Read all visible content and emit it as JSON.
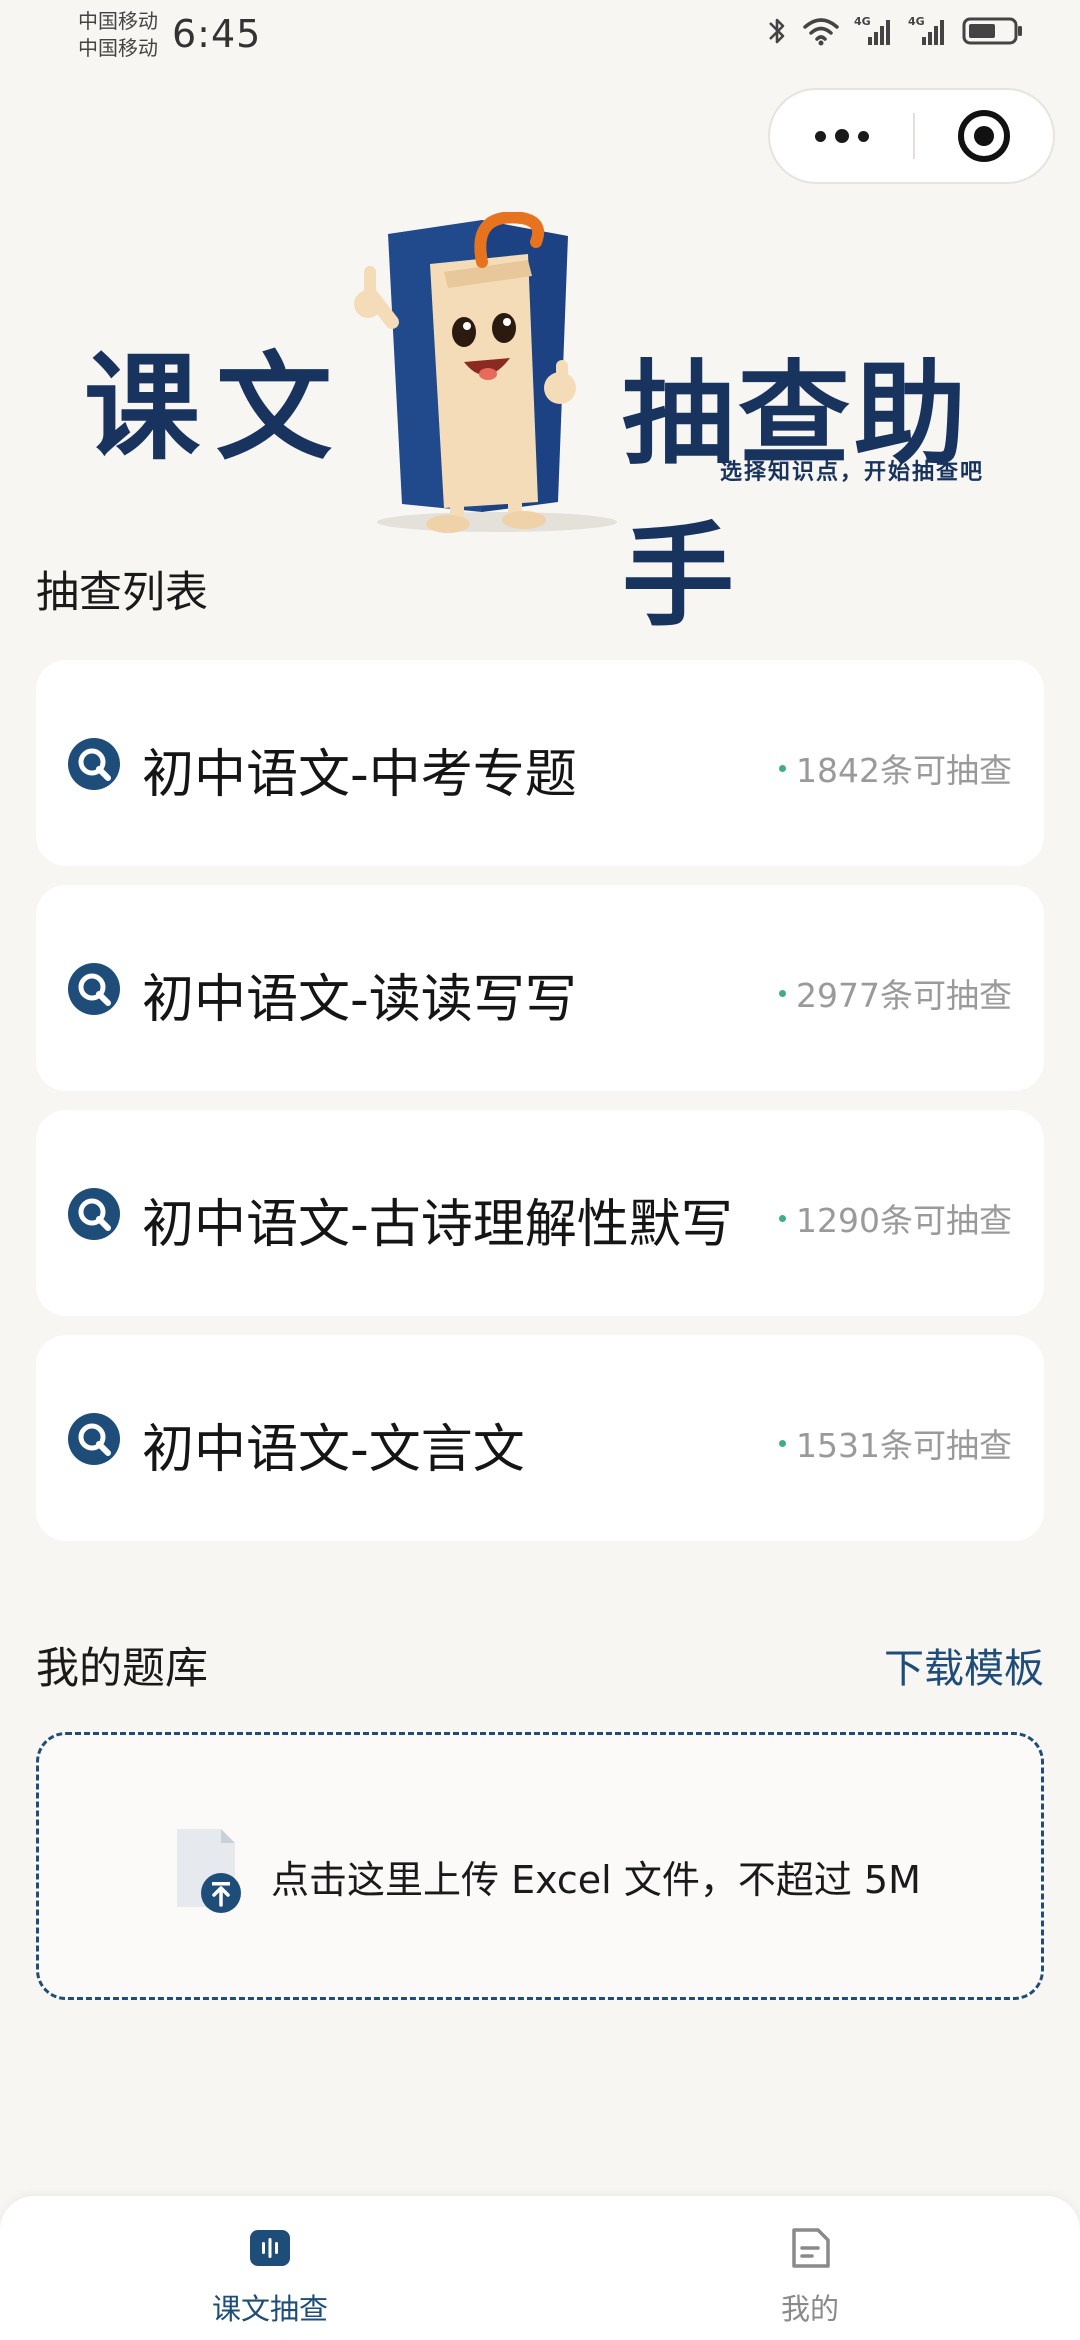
{
  "status_bar": {
    "carrier_1": "中国移动",
    "carrier_2": "中国移动",
    "time": "6:45",
    "icons": [
      "bluetooth-icon",
      "wifi-icon",
      "signal-4g-icon",
      "signal-4g-icon",
      "battery-icon"
    ],
    "network_1": "4G",
    "network_2": "4G"
  },
  "capsule": {
    "more_icon": "more-dots-icon",
    "close_icon": "target-close-icon"
  },
  "banner": {
    "title_left": "课文",
    "title_right": "抽查助手",
    "subtitle": "选择知识点，开始抽查吧",
    "mascot": "book-mascot-illustration"
  },
  "list_section": {
    "title": "抽查列表",
    "items": [
      {
        "title": "初中语文-中考专题",
        "count": "1842条可抽查"
      },
      {
        "title": "初中语文-读读写写",
        "count": "2977条可抽查"
      },
      {
        "title": "初中语文-古诗理解性默写",
        "count": "1290条可抽查"
      },
      {
        "title": "初中语文-文言文",
        "count": "1531条可抽查"
      }
    ]
  },
  "bank_section": {
    "title": "我的题库",
    "download_link": "下载模板",
    "upload_text": "点击这里上传 Excel 文件，不超过 5M",
    "upload_icon": "file-upload-icon"
  },
  "tabbar": {
    "tabs": [
      {
        "label": "课文抽查",
        "icon": "book-audio-icon",
        "active": true
      },
      {
        "label": "我的",
        "icon": "document-icon",
        "active": false
      }
    ]
  },
  "colors": {
    "accent": "#1f4d7a",
    "brand_dark": "#17335e",
    "background": "#f8f6f3",
    "count_dot": "#3fae86",
    "muted": "#9a9a9a"
  }
}
